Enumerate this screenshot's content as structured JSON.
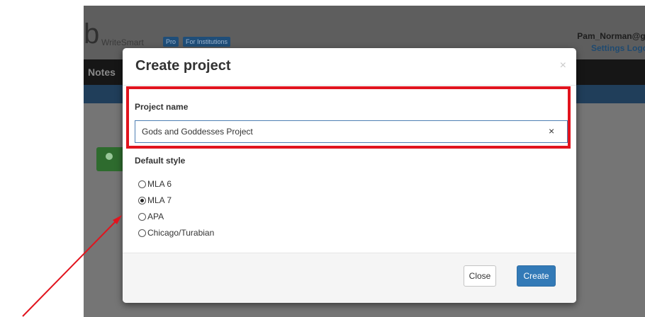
{
  "app": {
    "logo_letter": "b",
    "logo_text": "WriteSmart",
    "badges": [
      "Pro",
      "For Institutions"
    ],
    "user_email": "Pam_Norman@gw",
    "user_links": "Settings  Logo",
    "nav_item": "Notes"
  },
  "modal": {
    "title": "Create project",
    "close_x": "×",
    "name_label": "Project name",
    "name_value": "Gods and Goddesses Project",
    "clear_icon": "×",
    "style_label": "Default style",
    "styles": [
      {
        "label": "MLA 6",
        "selected": false
      },
      {
        "label": "MLA 7",
        "selected": true
      },
      {
        "label": "APA",
        "selected": false
      },
      {
        "label": "Chicago/Turabian",
        "selected": false
      }
    ],
    "close_button": "Close",
    "create_button": "Create"
  },
  "colors": {
    "highlight": "#e1141e",
    "primary": "#337ab7",
    "arrow": "#e1141e"
  }
}
